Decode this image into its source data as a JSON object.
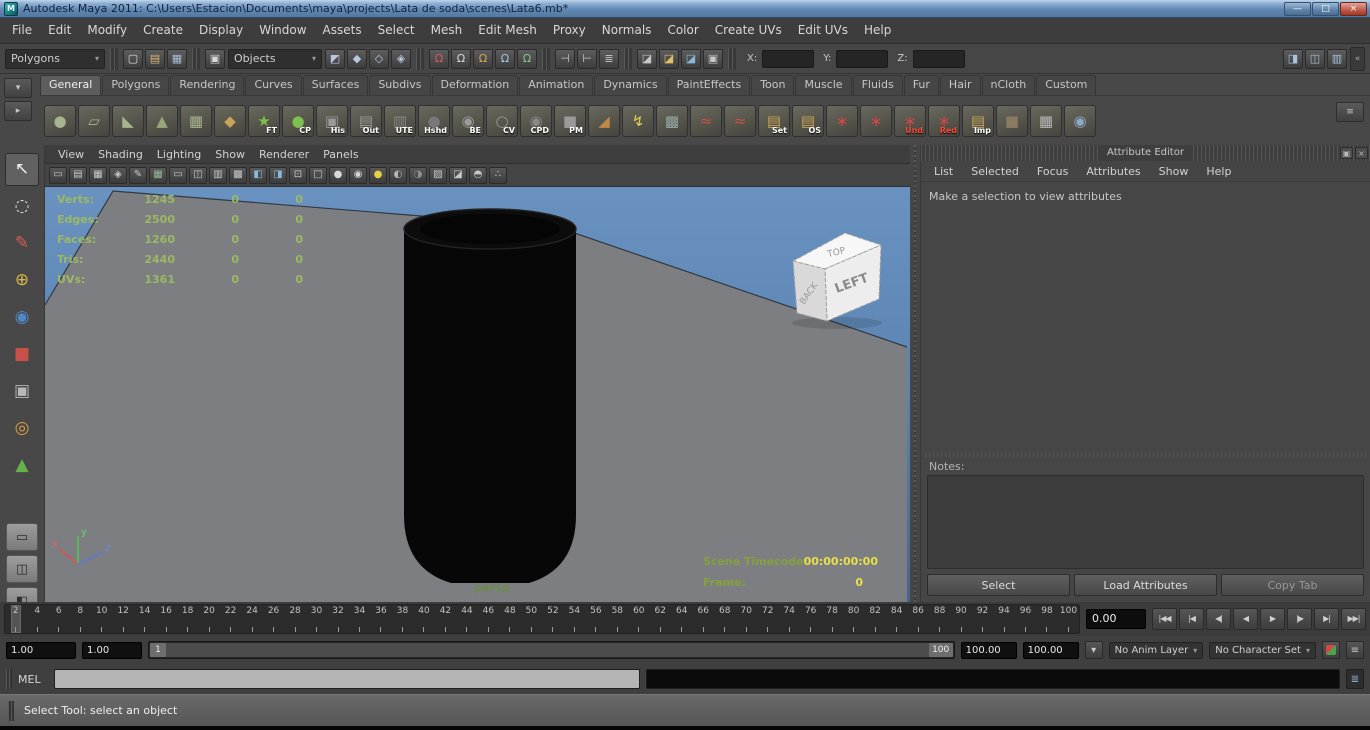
{
  "icons": {
    "chevron_down": "▾",
    "chevron_right": "▸",
    "collapse": "«",
    "menu": "≡",
    "script_editor": "≣",
    "mask": "▣"
  },
  "titlebar": {
    "title": "Autodesk Maya 2011: C:\\Users\\Estacion\\Documents\\maya\\projects\\Lata de soda\\scenes\\Lata6.mb*",
    "app_initial": "M",
    "minimize_glyph": "—",
    "maximize_glyph": "□",
    "close_glyph": "×"
  },
  "menubar": [
    "File",
    "Edit",
    "Modify",
    "Create",
    "Display",
    "Window",
    "Assets",
    "Select",
    "Mesh",
    "Edit Mesh",
    "Proxy",
    "Normals",
    "Color",
    "Create UVs",
    "Edit UVs",
    "Help"
  ],
  "statusline": {
    "mode": "Polygons",
    "objects": "Objects",
    "x_label": "X:",
    "y_label": "Y:",
    "z_label": "Z:",
    "x_value": "",
    "y_value": "",
    "z_value": "",
    "file_icons": [
      {
        "name": "new-scene-icon",
        "glyph": "▢",
        "color": "#e0e0e0"
      },
      {
        "name": "open-scene-icon",
        "glyph": "▤",
        "color": "#d8b878"
      },
      {
        "name": "save-scene-icon",
        "glyph": "▦",
        "color": "#a8bcd8"
      }
    ],
    "mask_icons": [
      {
        "name": "select-hierarchy-icon",
        "glyph": "◩",
        "color": "#b8c8e0"
      },
      {
        "name": "select-object-icon",
        "glyph": "◆",
        "color": "#b8c8e0"
      },
      {
        "name": "select-component-icon",
        "glyph": "◇",
        "color": "#b8c8e0"
      },
      {
        "name": "select-asset-icon",
        "glyph": "◈",
        "color": "#b8c8e0"
      }
    ],
    "snap_icons": [
      {
        "name": "snap-grid-icon",
        "glyph": "Ω",
        "color": "#e05858"
      },
      {
        "name": "snap-curve-icon",
        "glyph": "Ω",
        "color": "#d8d8d8"
      },
      {
        "name": "snap-point-icon",
        "glyph": "Ω",
        "color": "#d8a858"
      },
      {
        "name": "snap-plane-icon",
        "glyph": "Ω",
        "color": "#a8c8e8"
      },
      {
        "name": "make-live-icon",
        "glyph": "Ω",
        "color": "#88c888"
      }
    ],
    "history_icons": [
      {
        "name": "input-connections-icon",
        "glyph": "⊣",
        "color": "#c8c8c8"
      },
      {
        "name": "output-connections-icon",
        "glyph": "⊢",
        "color": "#c8c8c8"
      },
      {
        "name": "construction-history-icon",
        "glyph": "≣",
        "color": "#c8c8c8"
      }
    ],
    "render_icons": [
      {
        "name": "render-view-icon",
        "glyph": "◪",
        "color": "#c8c8c8"
      },
      {
        "name": "render-current-frame-icon",
        "glyph": "◪",
        "color": "#e0c060"
      },
      {
        "name": "ipr-render-icon",
        "glyph": "◪",
        "color": "#88b8d8"
      },
      {
        "name": "render-settings-icon",
        "glyph": "▣",
        "color": "#c8c8c8"
      }
    ],
    "right_icons": [
      {
        "name": "attribute-editor-toggle-icon",
        "glyph": "◨",
        "color": "#a8c4e0"
      },
      {
        "name": "tool-settings-toggle-icon",
        "glyph": "◫",
        "color": "#a8c4e0"
      },
      {
        "name": "channel-box-toggle-icon",
        "glyph": "▥",
        "color": "#a8c4e0"
      }
    ]
  },
  "shelf": {
    "active_tab": "General",
    "tabs": [
      "General",
      "Polygons",
      "Rendering",
      "Curves",
      "Surfaces",
      "Subdivs",
      "Deformation",
      "Animation",
      "Dynamics",
      "PaintEffects",
      "Toon",
      "Muscle",
      "Fluids",
      "Fur",
      "Hair",
      "nCloth",
      "Custom"
    ],
    "menu_buttons": [
      {
        "name": "shelf-tab-selector-icon",
        "glyph": "▾",
        "color": "#c8c8c8"
      },
      {
        "name": "shelf-menu-icon",
        "glyph": "▸",
        "color": "#c8c8c8"
      }
    ],
    "items": [
      {
        "name": "shelf-poly-sphere-icon",
        "glyph": "●",
        "color": "#a8b48e"
      },
      {
        "name": "shelf-poly-plane-icon",
        "glyph": "▱",
        "color": "#a8b48e"
      },
      {
        "name": "shelf-poly-wedge-icon",
        "glyph": "◣",
        "color": "#a8b48e"
      },
      {
        "name": "shelf-poly-cone-icon",
        "glyph": "▲",
        "color": "#98a67e"
      },
      {
        "name": "shelf-poly-grid-icon",
        "glyph": "▦",
        "color": "#a8b48e"
      },
      {
        "name": "shelf-poly-prism-icon",
        "glyph": "◆",
        "color": "#c8a458"
      },
      {
        "name": "shelf-freeze-transform-icon",
        "glyph": "★",
        "color": "#7ec04e",
        "label": "FT"
      },
      {
        "name": "shelf-center-pivot-icon",
        "glyph": "●",
        "color": "#7ec04e",
        "label": "CP"
      },
      {
        "name": "shelf-history-icon",
        "glyph": "▣",
        "color": "#9a9a9a",
        "label": "His"
      },
      {
        "name": "shelf-outliner-icon",
        "glyph": "▤",
        "color": "#9a9a9a",
        "label": "Out"
      },
      {
        "name": "shelf-ute-icon",
        "glyph": "▥",
        "color": "#888888",
        "label": "UTE"
      },
      {
        "name": "shelf-hypershade-icon",
        "glyph": "●",
        "color": "#787878",
        "label": "Hshd"
      },
      {
        "name": "shelf-be-icon",
        "glyph": "◉",
        "color": "#9a9a9a",
        "label": "BE"
      },
      {
        "name": "shelf-cv-curve-icon",
        "glyph": "○",
        "color": "#9a9a9a",
        "label": "CV"
      },
      {
        "name": "shelf-cpd-icon",
        "glyph": "◉",
        "color": "#8a8a8a",
        "label": "CPD"
      },
      {
        "name": "shelf-pm-icon",
        "glyph": "■",
        "color": "#9a9a9a",
        "label": "PM"
      },
      {
        "name": "shelf-paint-bucket-icon",
        "glyph": "◢",
        "color": "#c08848"
      },
      {
        "name": "shelf-lightning-icon",
        "glyph": "↯",
        "color": "#e0cc50"
      },
      {
        "name": "shelf-net-icon",
        "glyph": "▩",
        "color": "#98a8a8"
      },
      {
        "name": "shelf-ep-curve-icon",
        "glyph": "≈",
        "color": "#cc5044"
      },
      {
        "name": "shelf-pencil-curve-icon",
        "glyph": "≈",
        "color": "#cc5044"
      },
      {
        "name": "shelf-set-icon",
        "glyph": "▤",
        "color": "#c8a458",
        "label": "Set"
      },
      {
        "name": "shelf-os-icon",
        "glyph": "▤",
        "color": "#c8a458",
        "label": "OS"
      },
      {
        "name": "shelf-spike-a-icon",
        "glyph": "∗",
        "color": "#d04848"
      },
      {
        "name": "shelf-spike-b-icon",
        "glyph": "∗",
        "color": "#d04848"
      },
      {
        "name": "shelf-undo-icon",
        "glyph": "∗",
        "color": "#d04848",
        "label": "Und",
        "label_color": "#ff4838"
      },
      {
        "name": "shelf-redo-icon",
        "glyph": "∗",
        "color": "#d04848",
        "label": "Red",
        "label_color": "#ff4838"
      },
      {
        "name": "shelf-import-icon",
        "glyph": "▤",
        "color": "#c8a458",
        "label": "Imp"
      },
      {
        "name": "shelf-misc-icon",
        "glyph": "■",
        "color": "#8a7a62"
      },
      {
        "name": "shelf-lattice-icon",
        "glyph": "▦",
        "color": "#b8b8b8"
      },
      {
        "name": "shelf-rings-icon",
        "glyph": "◉",
        "color": "#90a8c8"
      }
    ]
  },
  "toolbox": {
    "tools": [
      {
        "name": "select-tool",
        "glyph": "↖",
        "color": "#f0f0f0",
        "active": true
      },
      {
        "name": "lasso-select-tool",
        "glyph": "◌",
        "color": "#e0e0e0"
      },
      {
        "name": "paint-select-tool",
        "glyph": "✎",
        "color": "#d06058"
      },
      {
        "name": "move-tool",
        "glyph": "⊕",
        "color": "#d8b848"
      },
      {
        "name": "rotate-tool",
        "glyph": "◉",
        "color": "#5088c8"
      },
      {
        "name": "scale-tool",
        "glyph": "■",
        "color": "#c85048"
      },
      {
        "name": "universal-manipulator-tool",
        "glyph": "▣",
        "color": "#b8b8b8"
      },
      {
        "name": "soft-modification-tool",
        "glyph": "◎",
        "color": "#d8a040"
      },
      {
        "name": "show-manipulator-tool",
        "glyph": "▲",
        "color": "#68b048"
      },
      {
        "name": "last-tool",
        "glyph": "",
        "color": "#cccccc"
      }
    ],
    "layouts": [
      {
        "name": "single-pane-layout-button",
        "glyph": "▭",
        "color": "#2e2e2e"
      },
      {
        "name": "two-pane-layout-button",
        "glyph": "◫",
        "color": "#2e2e2e"
      },
      {
        "name": "persp-outliner-layout-button",
        "glyph": "◧",
        "color": "#2e2e2e"
      }
    ]
  },
  "panel": {
    "menus": [
      "View",
      "Shading",
      "Lighting",
      "Show",
      "Renderer",
      "Panels"
    ],
    "toolbar_icons": [
      {
        "name": "camera-attributes-icon",
        "glyph": "▭",
        "color": "#c8c8c8"
      },
      {
        "name": "bookmarks-icon",
        "glyph": "▤",
        "color": "#c8c8c8"
      },
      {
        "name": "image-plane-icon",
        "glyph": "▦",
        "color": "#c8c8c8"
      },
      {
        "name": "view-compass-icon",
        "glyph": "◈",
        "color": "#c8c8c8"
      },
      {
        "name": "grease-pencil-icon",
        "glyph": "✎",
        "color": "#c8c8c8"
      },
      {
        "name": "grid-toggle-icon",
        "glyph": "▦",
        "color": "#9ab89a"
      },
      {
        "name": "film-gate-icon",
        "glyph": "▭",
        "color": "#c8c8c8"
      },
      {
        "name": "resolution-gate-icon",
        "glyph": "◫",
        "color": "#c8c8c8"
      },
      {
        "name": "gate-mask-icon",
        "glyph": "▥",
        "color": "#c8c8c8"
      },
      {
        "name": "field-chart-icon",
        "glyph": "▩",
        "color": "#c8c8c8"
      },
      {
        "name": "safe-action-icon",
        "glyph": "◧",
        "color": "#88b8d8"
      },
      {
        "name": "safe-title-icon",
        "glyph": "◨",
        "color": "#88b8d8"
      },
      {
        "name": "frame-all-icon",
        "glyph": "⊡",
        "color": "#c8c8c8"
      },
      {
        "name": "wireframe-mode-icon",
        "glyph": "□",
        "color": "#c8c8c8"
      },
      {
        "name": "shaded-mode-icon",
        "glyph": "●",
        "color": "#d8d8d8"
      },
      {
        "name": "textured-mode-icon",
        "glyph": "◉",
        "color": "#d8d8d8"
      },
      {
        "name": "default-light-icon",
        "glyph": "●",
        "color": "#e8d048"
      },
      {
        "name": "all-lights-icon",
        "glyph": "◐",
        "color": "#b8b8b8"
      },
      {
        "name": "shadows-icon",
        "glyph": "◑",
        "color": "#909090"
      },
      {
        "name": "xray-mode-icon",
        "glyph": "▨",
        "color": "#c8c8c8"
      },
      {
        "name": "isolate-select-icon",
        "glyph": "◪",
        "color": "#c8c8c8"
      },
      {
        "name": "exposure-icon",
        "glyph": "◓",
        "color": "#c8c8c8"
      },
      {
        "name": "share-view-icon",
        "glyph": "∴",
        "color": "#c8c8c8"
      }
    ]
  },
  "viewport": {
    "hud": [
      {
        "label": "Verts:",
        "a": "1245",
        "b": "0",
        "c": "0"
      },
      {
        "label": "Edges:",
        "a": "2500",
        "b": "0",
        "c": "0"
      },
      {
        "label": "Faces:",
        "a": "1260",
        "b": "0",
        "c": "0"
      },
      {
        "label": "Tris:",
        "a": "2440",
        "b": "0",
        "c": "0"
      },
      {
        "label": "UVs:",
        "a": "1361",
        "b": "0",
        "c": "0"
      }
    ],
    "camera": "persp",
    "timecode_label": "Scene Timecode:",
    "timecode_value": "00:00:00:00",
    "frame_label": "Frame:",
    "frame_value": "0",
    "cube": {
      "front": "LEFT",
      "side": "BACK",
      "top": "TOP"
    },
    "axes": {
      "x": "x",
      "y": "y",
      "z": "z"
    }
  },
  "attribute_editor": {
    "title": "Attribute Editor",
    "menus": [
      "List",
      "Selected",
      "Focus",
      "Attributes",
      "Show",
      "Help"
    ],
    "message": "Make a selection to view attributes",
    "notes_label": "Notes:",
    "select_button": "Select",
    "load_button": "Load Attributes",
    "copy_button": "Copy Tab",
    "float_glyph": "▣",
    "close_glyph": "×"
  },
  "timeline": {
    "start": 2,
    "end": 100,
    "step": 2,
    "current_time": "0.00",
    "playback": [
      {
        "name": "go-to-start-button",
        "glyph": "|◀◀"
      },
      {
        "name": "step-back-frame-button",
        "glyph": "|◀"
      },
      {
        "name": "step-back-key-button",
        "glyph": "◀|"
      },
      {
        "name": "play-backwards-button",
        "glyph": "◀"
      },
      {
        "name": "play-forwards-button",
        "glyph": "▶"
      },
      {
        "name": "step-forward-key-button",
        "glyph": "|▶"
      },
      {
        "name": "step-forward-frame-button",
        "glyph": "▶|"
      },
      {
        "name": "go-to-end-button",
        "glyph": "▶▶|"
      }
    ]
  },
  "range": {
    "anim_start": "1.00",
    "playback_start": "1.00",
    "range_start_label": "1",
    "range_end_label": "100",
    "playback_end": "100.00",
    "anim_end": "100.00",
    "anim_layer": "No Anim Layer",
    "character_set": "No Character Set"
  },
  "command_line": {
    "label": "MEL"
  },
  "help_line": {
    "text": "Select Tool: select an object"
  }
}
